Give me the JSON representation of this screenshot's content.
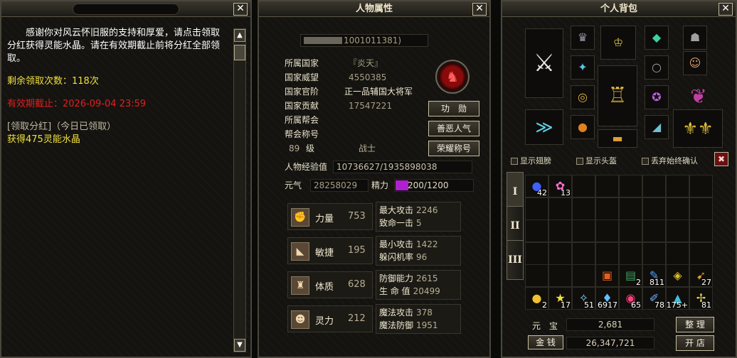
{
  "panel_left": {
    "message_main": "感谢你对风云怀旧服的支持和厚爱，请点击领取分红获得灵能水晶。请在有效期截止前将分红全部领取。",
    "remaining": "剩余领取次数：118次",
    "expiry": "有效期截止：2026-09-04 23:59",
    "claim_status": "[领取分红]（今日已领取）",
    "reward": "获得475灵能水晶",
    "close_label": "✕"
  },
  "panel_char": {
    "title": "人物属性",
    "close_label": "✕",
    "id_text": "1001011381)",
    "rows": [
      {
        "label": "所属国家",
        "value": "『炎天』"
      },
      {
        "label": "国家威望",
        "value": "4550385"
      },
      {
        "label": "国家官阶",
        "value": "正一品辅国大将军"
      },
      {
        "label": "国家贡献",
        "value": "17547221"
      },
      {
        "label": "所属帮会",
        "value": ""
      },
      {
        "label": "帮会称号",
        "value": ""
      }
    ],
    "level": "89",
    "level_unit": "级",
    "class_name": "战士",
    "buttons": {
      "merit": "功　勋",
      "karma": "善恶人气",
      "honor": "荣耀称号"
    },
    "exp_label": "人物经验值",
    "exp_value": "10736627/1935898038",
    "yuanqi_label": "元气",
    "yuanqi_value": "28258029",
    "jingli_label": "精力",
    "jingli_value": "200/1200",
    "jingli_fraction": 0.1667,
    "stats": [
      {
        "name": "力量",
        "value": "753",
        "icon": "fist-icon",
        "sub": [
          {
            "label": "最大攻击",
            "value": "2246"
          },
          {
            "label": "致命一击",
            "value": "5"
          }
        ]
      },
      {
        "name": "敏捷",
        "value": "195",
        "icon": "boot-icon",
        "sub": [
          {
            "label": "最小攻击",
            "value": "1422"
          },
          {
            "label": "躲闪机率",
            "value": "96"
          }
        ]
      },
      {
        "name": "体质",
        "value": "628",
        "icon": "torso-icon",
        "sub": [
          {
            "label": "防御能力",
            "value": "2615"
          },
          {
            "label": "生 命 值",
            "value": "20499"
          }
        ]
      },
      {
        "name": "灵力",
        "value": "212",
        "icon": "head-icon",
        "sub": [
          {
            "label": "魔法攻击",
            "value": "378"
          },
          {
            "label": "魔法防御",
            "value": "1951"
          }
        ]
      }
    ]
  },
  "panel_bag": {
    "title": "个人背包",
    "close_label": "✕",
    "checks": {
      "wings": "显示翅膀",
      "helmet": "显示头盔",
      "discard": "丢弃始终确认"
    },
    "tabs": [
      "I",
      "II",
      "III"
    ],
    "items": [
      {
        "count": "42"
      },
      {
        "count": "13"
      },
      {
        "count": ""
      },
      {
        "count": "2"
      },
      {
        "count": "811"
      },
      {
        "count": ""
      },
      {
        "count": "27"
      },
      {
        "count": "2"
      },
      {
        "count": "17"
      },
      {
        "count": "51"
      },
      {
        "count": "6917"
      },
      {
        "count": "65"
      },
      {
        "count": "78"
      },
      {
        "count": "175+"
      },
      {
        "count": "81"
      }
    ],
    "yuanbao_label": "元　宝",
    "yuanbao_value": "2,681",
    "gold_label": "金 钱",
    "gold_value": "26,347,721",
    "btn_sort": "整 理",
    "btn_shop": "开 店"
  }
}
